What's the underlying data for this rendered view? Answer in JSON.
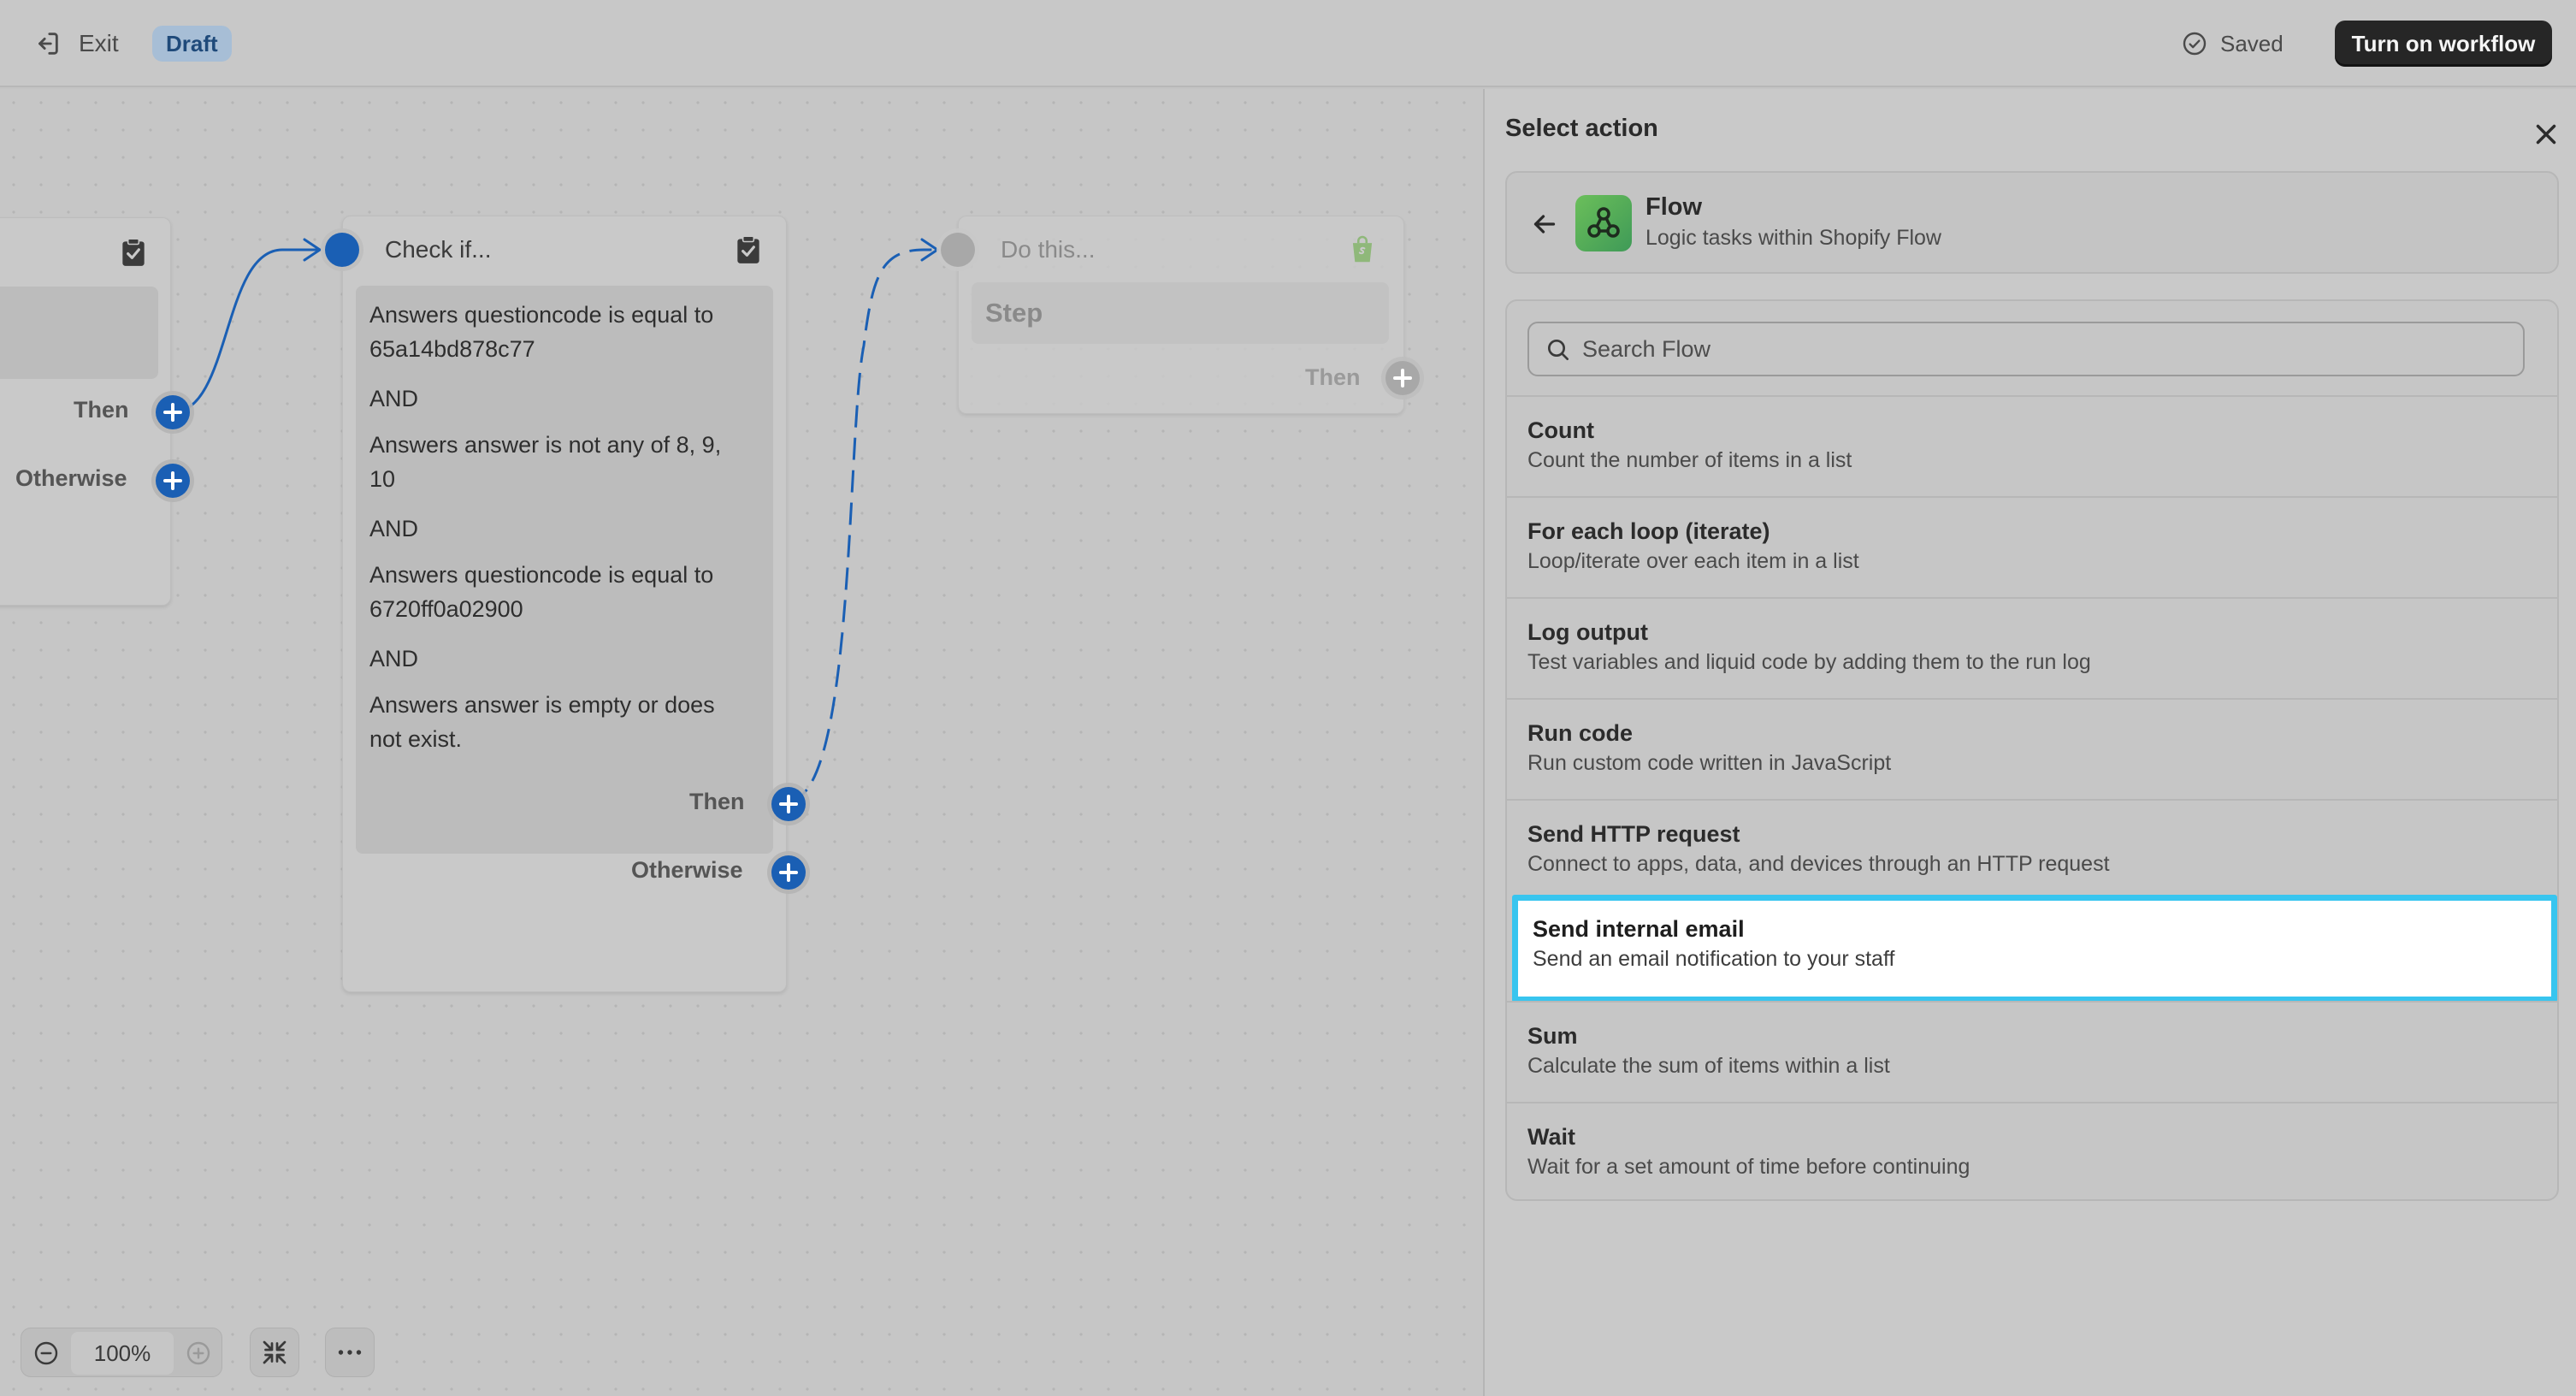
{
  "topbar": {
    "exit_label": "Exit",
    "status_badge": "Draft",
    "saved_label": "Saved",
    "turn_on_label": "Turn on workflow"
  },
  "canvas": {
    "node_left": {
      "then_label": "Then",
      "otherwise_label": "Otherwise"
    },
    "node_condition": {
      "title": "Check if...",
      "lines": [
        "Answers questioncode is equal to",
        "65a14bd878c77",
        "AND",
        "Answers answer is not any of 8, 9,",
        "10",
        "AND",
        "Answers questioncode is equal to",
        "6720ff0a02900",
        "AND",
        "Answers answer is empty or does",
        "not exist."
      ],
      "then_label": "Then",
      "otherwise_label": "Otherwise"
    },
    "node_action": {
      "title": "Do this...",
      "step_label": "Step",
      "then_label": "Then"
    },
    "zoom": {
      "value": "100%"
    }
  },
  "panel": {
    "title": "Select action",
    "app": {
      "name": "Flow",
      "description": "Logic tasks within Shopify Flow"
    },
    "search": {
      "placeholder": "Search Flow",
      "value": ""
    },
    "actions": [
      {
        "title": "Count",
        "description": "Count the number of items in a list"
      },
      {
        "title": "For each loop (iterate)",
        "description": "Loop/iterate over each item in a list"
      },
      {
        "title": "Log output",
        "description": "Test variables and liquid code by adding them to the run log"
      },
      {
        "title": "Run code",
        "description": "Run custom code written in JavaScript"
      },
      {
        "title": "Send HTTP request",
        "description": "Connect to apps, data, and devices through an HTTP request"
      },
      {
        "title": "Send internal email",
        "description": "Send an email notification to your staff"
      },
      {
        "title": "Sum",
        "description": "Calculate the sum of items within a list"
      },
      {
        "title": "Wait",
        "description": "Wait for a set amount of time before continuing"
      }
    ],
    "highlighted_action": "Send internal email"
  },
  "colors": {
    "accent_blue": "#1a5fb4",
    "highlight_border": "#38c5ef",
    "primary_button": "#262626",
    "flow_logo": "#4fa857"
  },
  "icons": {
    "exit": "exit-icon",
    "saved": "check-circle-icon",
    "clipboard": "clipboard-check-icon",
    "shopify": "shopify-bag-icon",
    "close": "close-icon",
    "back": "arrow-left-icon",
    "search": "search-icon",
    "zoom_out": "minus-circle-icon",
    "zoom_in": "plus-circle-icon",
    "fit": "collapse-icon",
    "more": "more-horizontal-icon"
  }
}
